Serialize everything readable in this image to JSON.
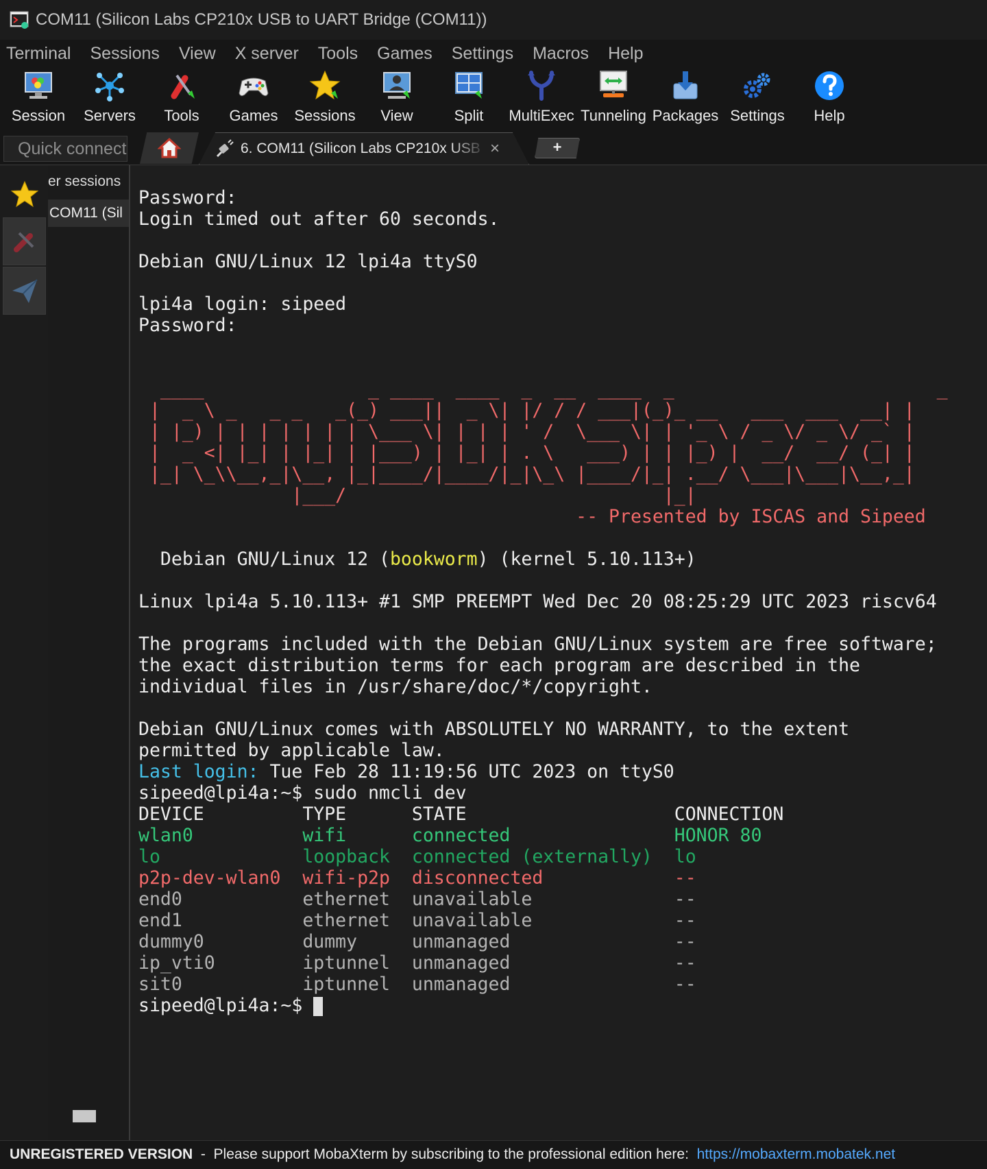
{
  "window": {
    "title": "COM11  (Silicon Labs CP210x USB to UART Bridge (COM11))"
  },
  "menu": [
    "Terminal",
    "Sessions",
    "View",
    "X server",
    "Tools",
    "Games",
    "Settings",
    "Macros",
    "Help"
  ],
  "toolbar": [
    {
      "label": "Session",
      "icon": "monitor-icon"
    },
    {
      "label": "Servers",
      "icon": "servers-icon"
    },
    {
      "label": "Tools",
      "icon": "tools-icon"
    },
    {
      "label": "Games",
      "icon": "gamepad-icon"
    },
    {
      "label": "Sessions",
      "icon": "star-icon"
    },
    {
      "label": "View",
      "icon": "view-icon"
    },
    {
      "label": "Split",
      "icon": "split-icon"
    },
    {
      "label": "MultiExec",
      "icon": "multiexec-icon"
    },
    {
      "label": "Tunneling",
      "icon": "tunneling-icon"
    },
    {
      "label": "Packages",
      "icon": "packages-icon"
    },
    {
      "label": "Settings",
      "icon": "gears-icon"
    },
    {
      "label": "Help",
      "icon": "help-icon"
    }
  ],
  "tabs": {
    "quick_connect_placeholder": "Quick connect...",
    "home_icon": "home-icon",
    "session_tab": "6. COM11  (Silicon Labs CP210x USB",
    "close": "×",
    "new_tab": "+"
  },
  "sidebar": {
    "header": "er sessions",
    "session_item": "COM11  (Sil"
  },
  "terminal": {
    "lines": [
      [
        {
          "t": "Password:"
        }
      ],
      [
        {
          "t": "Login timed out after 60 seconds."
        }
      ],
      [
        {
          "t": ""
        }
      ],
      [
        {
          "t": "Debian GNU/Linux 12 lpi4a ttyS0"
        }
      ],
      [
        {
          "t": ""
        }
      ],
      [
        {
          "t": "lpi4a login: sipeed"
        }
      ],
      [
        {
          "t": "Password:"
        }
      ],
      [
        {
          "t": ""
        }
      ],
      [
        {
          "t": ""
        }
      ],
      [
        {
          "t": "  ____               _ ____  ____  _  __  ____  _                        _ ",
          "c": "red"
        }
      ],
      [
        {
          "t": " |  _ \\ _   _ _   _(_) ___||  _ \\| |/ / / ___|(_)_ __   ___  ___  __| |",
          "c": "red"
        }
      ],
      [
        {
          "t": " | |_) | | | | | | | \\___ \\| | | | ' /  \\___ \\| | '_ \\ / _ \\/ _ \\/ _` |",
          "c": "red"
        }
      ],
      [
        {
          "t": " |  _ <| |_| | |_| | |___) | |_| | . \\   ___) | | |_) |  __/  __/ (_| |",
          "c": "red"
        }
      ],
      [
        {
          "t": " |_| \\_\\\\__,_|\\__, |_|____/|____/|_|\\_\\ |____/|_| .__/ \\___|\\___|\\__,_|",
          "c": "red"
        }
      ],
      [
        {
          "t": "              |___/                             |_|                     ",
          "c": "red"
        }
      ],
      [
        {
          "t": "                                        -- Presented by ISCAS and Sipeed",
          "c": "red"
        }
      ],
      [
        {
          "t": ""
        }
      ],
      [
        {
          "t": "  Debian GNU/Linux 12 ("
        },
        {
          "t": "bookworm",
          "c": "yel"
        },
        {
          "t": ") (kernel 5.10.113+)"
        }
      ],
      [
        {
          "t": ""
        }
      ],
      [
        {
          "t": "Linux lpi4a 5.10.113+ #1 SMP PREEMPT Wed Dec 20 08:25:29 UTC 2023 riscv64"
        }
      ],
      [
        {
          "t": ""
        }
      ],
      [
        {
          "t": "The programs included with the Debian GNU/Linux system are free software;"
        }
      ],
      [
        {
          "t": "the exact distribution terms for each program are described in the"
        }
      ],
      [
        {
          "t": "individual files in /usr/share/doc/*/copyright."
        }
      ],
      [
        {
          "t": ""
        }
      ],
      [
        {
          "t": "Debian GNU/Linux comes with ABSOLUTELY NO WARRANTY, to the extent"
        }
      ],
      [
        {
          "t": "permitted by applicable law."
        }
      ],
      [
        {
          "t": "Last login:",
          "c": "cyan"
        },
        {
          "t": " Tue Feb 28 11:19:56 UTC 2023 on ttyS0"
        }
      ],
      [
        {
          "t": "sipeed@lpi4a:~$ sudo nmcli dev"
        }
      ],
      [
        {
          "t": "DEVICE         TYPE      STATE                   CONNECTION "
        }
      ],
      [
        {
          "t": "wlan0          wifi      connected               HONOR 80   ",
          "c": "grn"
        }
      ],
      [
        {
          "t": "lo             loopback  connected (externally)  lo         ",
          "c": "dgrn"
        }
      ],
      [
        {
          "t": "p2p-dev-wlan0  wifi-p2p  disconnected            --         ",
          "c": "red"
        }
      ],
      [
        {
          "t": "end0           ethernet  unavailable             --         ",
          "c": "gry"
        }
      ],
      [
        {
          "t": "end1           ethernet  unavailable             --         ",
          "c": "gry"
        }
      ],
      [
        {
          "t": "dummy0         dummy     unmanaged               --         ",
          "c": "gry"
        }
      ],
      [
        {
          "t": "ip_vti0        iptunnel  unmanaged               --         ",
          "c": "gry"
        }
      ],
      [
        {
          "t": "sit0           iptunnel  unmanaged               --         ",
          "c": "gry"
        }
      ],
      [
        {
          "t": "sipeed@lpi4a:~$ "
        }
      ]
    ]
  },
  "status": {
    "unregistered": "UNREGISTERED VERSION",
    "message": "  -  Please support MobaXterm by subscribing to the professional edition here:  ",
    "link": "https://mobaxterm.mobatek.net"
  }
}
